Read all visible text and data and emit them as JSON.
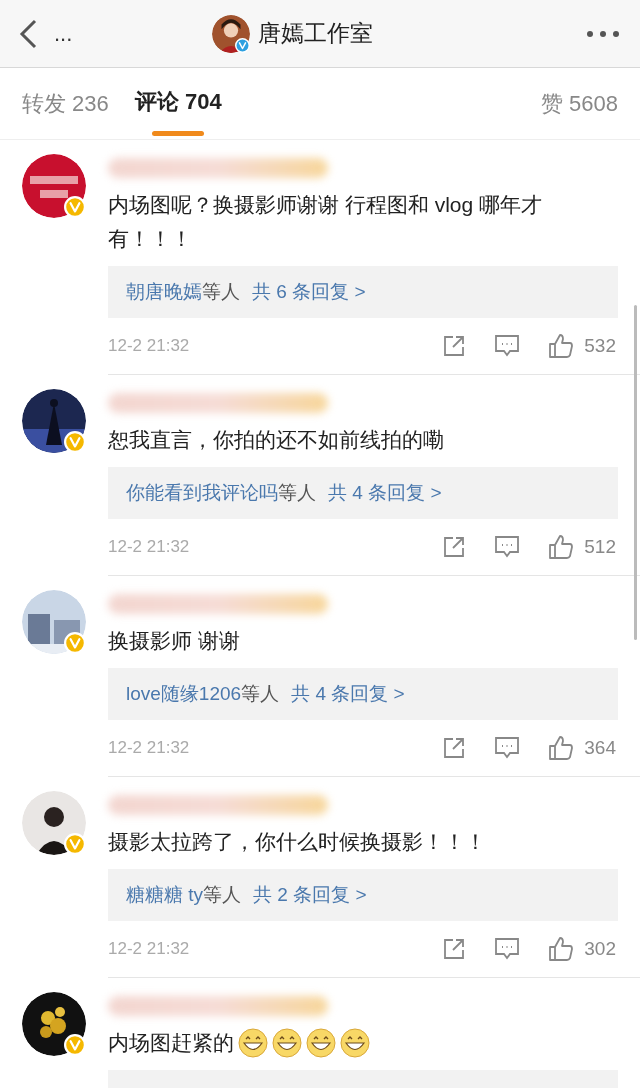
{
  "header": {
    "back_dots": "...",
    "title": "唐嫣工作室",
    "avatar": {
      "kind": "picture"
    }
  },
  "tabs": [
    {
      "label": "转发 236",
      "selected": false
    },
    {
      "label": "评论 704",
      "selected": true
    },
    {
      "label": "赞 5608",
      "selected": false
    }
  ],
  "comments": [
    {
      "avatar": {
        "kind": "picture"
      },
      "text": "内场图呢？换摄影师谢谢 行程图和 vlog 哪年才有！！！",
      "replies": {
        "users": "朝唐晚嫣",
        "suffix": "等人",
        "count": "共 6 条回复 >"
      },
      "time": "12-2 21:32",
      "likes": "532"
    },
    {
      "avatar": {
        "kind": "picture"
      },
      "text": "恕我直言，你拍的还不如前线拍的嘞",
      "replies": {
        "users": "你能看到我评论吗",
        "suffix": "等人",
        "count": "共 4 条回复 >"
      },
      "time": "12-2 21:32",
      "likes": "512"
    },
    {
      "avatar": {
        "kind": "picture"
      },
      "text": "换摄影师 谢谢",
      "replies": {
        "users": "love随缘1206",
        "suffix": "等人",
        "count": "共 4 条回复 >"
      },
      "time": "12-2 21:32",
      "likes": "364"
    },
    {
      "avatar": {
        "kind": "picture"
      },
      "text": "摄影太拉跨了，你什么时候换摄影！！！",
      "replies": {
        "users": "糖糖糖 ty",
        "suffix": "等人",
        "count": "共 2 条回复 >"
      },
      "time": "12-2 21:32",
      "likes": "302"
    },
    {
      "avatar": {
        "kind": "picture"
      },
      "text": "内场图赶紧的",
      "emojis": [
        {
          "kind": "grin"
        },
        {
          "kind": "grin"
        },
        {
          "kind": "grin"
        },
        {
          "kind": "grin"
        }
      ]
    }
  ]
}
